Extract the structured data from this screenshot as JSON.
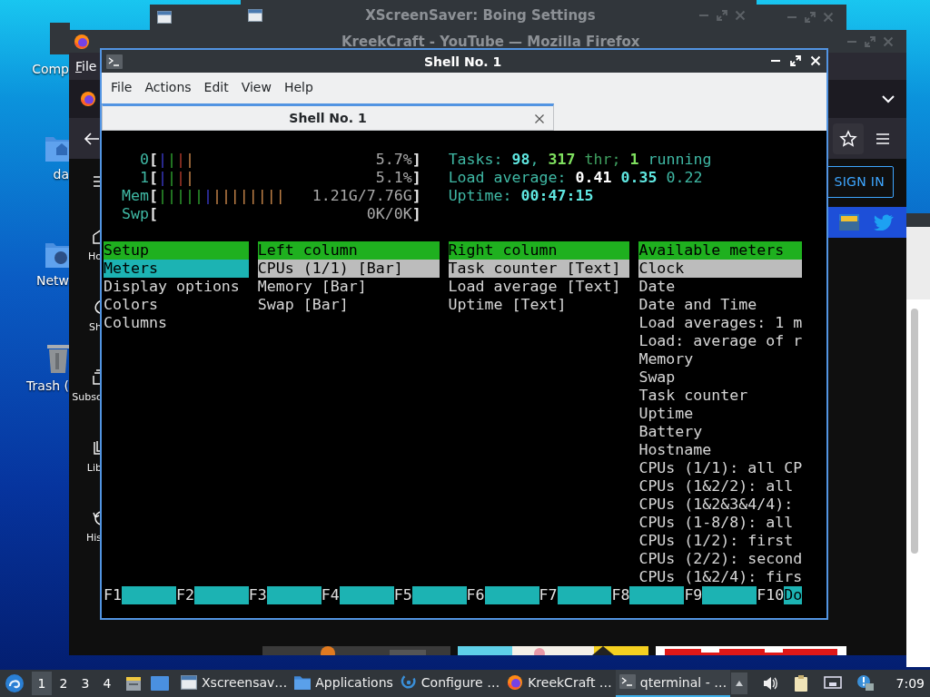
{
  "desktop_icons": [
    {
      "label": "Comp"
    },
    {
      "label": "da",
      "kind": "home-folder"
    },
    {
      "label": "Netw",
      "kind": "network-folder"
    },
    {
      "label": "Trash (",
      "kind": "trash"
    }
  ],
  "xscreensaver_window": {
    "title": "XScreenSaver: Boing Settings"
  },
  "browser": {
    "title": "KreekCraft - YouTube — Mozilla Firefox",
    "menu": [
      "File"
    ],
    "sidebar": [
      {
        "label": "Ho",
        "kind": "home"
      },
      {
        "label": "Sh",
        "kind": "shorts"
      },
      {
        "label": "Subsc",
        "kind": "subscriptions"
      },
      {
        "label": "Lib",
        "kind": "library"
      },
      {
        "label": "His",
        "kind": "history"
      }
    ],
    "sign_in": "SIGN IN"
  },
  "terminal": {
    "title": "Shell No. 1",
    "menu": [
      "File",
      "Actions",
      "Edit",
      "View",
      "Help"
    ],
    "tabs": [
      {
        "label": "Shell No. 1",
        "selected": true
      }
    ],
    "meters": [
      {
        "label": "0",
        "open": "[",
        "segments": [
          {
            "text": "|",
            "kind": "low"
          },
          {
            "text": "|",
            "kind": "normal"
          },
          {
            "text": "|",
            "kind": "kernel"
          },
          {
            "text": "|",
            "kind": "irq"
          }
        ],
        "value": "5.7%",
        "close": "]"
      },
      {
        "label": "1",
        "open": "[",
        "segments": [
          {
            "text": "|",
            "kind": "low"
          },
          {
            "text": "|",
            "kind": "normal"
          },
          {
            "text": "|",
            "kind": "kernel"
          },
          {
            "text": "|",
            "kind": "irq"
          }
        ],
        "value": "5.1%",
        "close": "]"
      },
      {
        "label": "Mem",
        "open": "[",
        "segments": [
          {
            "text": "|||||",
            "kind": "used"
          },
          {
            "text": "|",
            "kind": "buffers"
          },
          {
            "text": "||||||||",
            "kind": "cache"
          }
        ],
        "value": "1.21G/7.76G",
        "close": "]"
      },
      {
        "label": "Swp",
        "open": "[",
        "value": "0K/0K",
        "close": "]"
      }
    ],
    "summary": [
      [
        {
          "text": "Tasks: ",
          "color": "#3fb8a4"
        },
        {
          "text": "98",
          "color": "#5fe6e0",
          "bold": true
        },
        {
          "text": ", ",
          "color": "#3fb8a4"
        },
        {
          "text": "317",
          "color": "#7fe05f",
          "bold": true
        },
        {
          "text": " thr; ",
          "color": "#3fa060"
        },
        {
          "text": "1",
          "color": "#7fe05f",
          "bold": true
        },
        {
          "text": " running",
          "color": "#3fb8a4"
        }
      ],
      [
        {
          "text": "Load average: ",
          "color": "#3fb8a4"
        },
        {
          "text": "0.41 ",
          "color": "#ffffff",
          "bold": true
        },
        {
          "text": "0.35 ",
          "color": "#5fe6e0",
          "bold": true
        },
        {
          "text": "0.22",
          "color": "#3fb8a4"
        }
      ],
      [
        {
          "text": "Uptime: ",
          "color": "#3fb8a4"
        },
        {
          "text": "00:47:15",
          "color": "#5fe6e0",
          "bold": true
        }
      ]
    ],
    "panels": [
      {
        "header": "Setup",
        "focused": true,
        "items": [
          {
            "label": "Meters",
            "selected": true
          },
          {
            "label": "Display options",
            "selected": false
          },
          {
            "label": "Colors",
            "selected": false
          },
          {
            "label": "Columns",
            "selected": false
          }
        ]
      },
      {
        "header": "Left column",
        "focused": false,
        "items": [
          {
            "label": "CPUs (1/1) [Bar]",
            "selected": true
          },
          {
            "label": "Memory [Bar]",
            "selected": false
          },
          {
            "label": "Swap [Bar]",
            "selected": false
          }
        ]
      },
      {
        "header": "Right column",
        "focused": false,
        "items": [
          {
            "label": "Task counter [Text]",
            "selected": true
          },
          {
            "label": "Load average [Text]",
            "selected": false
          },
          {
            "label": "Uptime [Text]",
            "selected": false
          }
        ]
      },
      {
        "header": "Available meters",
        "focused": false,
        "items": [
          {
            "label": "Clock",
            "selected": true
          },
          {
            "label": "Date",
            "selected": false
          },
          {
            "label": "Date and Time",
            "selected": false
          },
          {
            "label": "Load averages: 1 m",
            "selected": false
          },
          {
            "label": "Load: average of r",
            "selected": false
          },
          {
            "label": "Memory",
            "selected": false
          },
          {
            "label": "Swap",
            "selected": false
          },
          {
            "label": "Task counter",
            "selected": false
          },
          {
            "label": "Uptime",
            "selected": false
          },
          {
            "label": "Battery",
            "selected": false
          },
          {
            "label": "Hostname",
            "selected": false
          },
          {
            "label": "CPUs (1/1): all CP",
            "selected": false
          },
          {
            "label": "CPUs (1&2/2): all",
            "selected": false
          },
          {
            "label": "CPUs (1&2&3&4/4):",
            "selected": false
          },
          {
            "label": "CPUs (1-8/8): all",
            "selected": false
          },
          {
            "label": "CPUs (1/2): first",
            "selected": false
          },
          {
            "label": "CPUs (2/2): second",
            "selected": false
          },
          {
            "label": "CPUs (1&2/4): firs",
            "selected": false
          }
        ]
      }
    ],
    "function_keys": [
      {
        "key": "F1"
      },
      {
        "key": "F2"
      },
      {
        "key": "F3"
      },
      {
        "key": "F4"
      },
      {
        "key": "F5"
      },
      {
        "key": "F6"
      },
      {
        "key": "F7"
      },
      {
        "key": "F8"
      },
      {
        "key": "F9"
      },
      {
        "key": "F10",
        "label": "Do"
      }
    ]
  },
  "taskbar": {
    "workspaces": [
      {
        "label": "1",
        "selected": true
      },
      {
        "label": "2",
        "selected": false
      },
      {
        "label": "3",
        "selected": false
      },
      {
        "label": "4",
        "selected": false
      }
    ],
    "tasks": [
      {
        "label": "Xscreensav…",
        "kind": "window",
        "selected": false
      },
      {
        "label": "Applications",
        "kind": "folder",
        "selected": false
      },
      {
        "label": "Configure …",
        "kind": "settings",
        "selected": false
      },
      {
        "label": "KreekCraft …",
        "kind": "browser",
        "selected": false
      },
      {
        "label": "qterminal - …",
        "kind": "terminal",
        "selected": true
      }
    ],
    "clock": "7:09"
  }
}
